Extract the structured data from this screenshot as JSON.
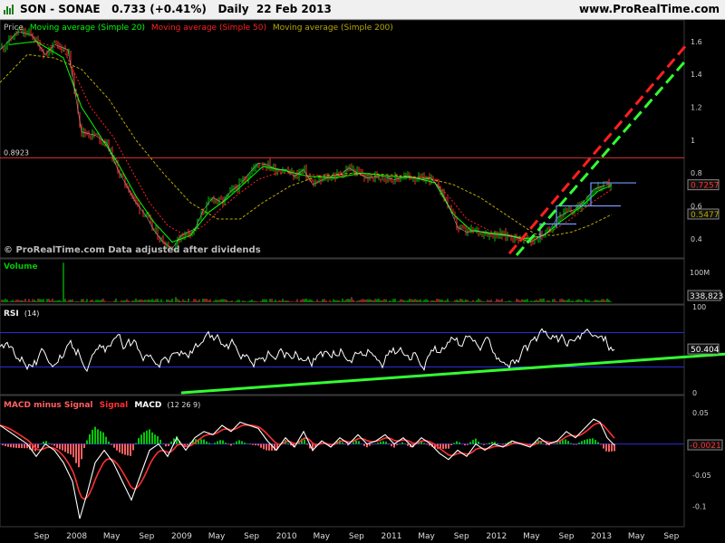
{
  "header": {
    "title": "SON - SONAE   0.733 (+0.41%)   Daily  22 Feb 2013",
    "brand": "www.ProRealTime.com"
  },
  "legend": {
    "price": "Price",
    "ma20": "Moving average (Simple 20)",
    "ma50": "Moving average (Simple 50)",
    "ma200": "Moving average (Simple 200)"
  },
  "credits": "© ProRealTime.com  Data adjusted after dividends",
  "colors": {
    "background": "#000000",
    "price_bull": "#00c800",
    "price_bear": "#ff3030",
    "ma20": "#00ff00",
    "ma50": "#ff2020",
    "ma200": "#b8a800",
    "rsi": "#ffffff",
    "band": "#2b2bd8",
    "macd": "#ffffff",
    "signal": "#ff3030",
    "trend": "#33ff33",
    "channel_red": "#ff2020",
    "channel_green": "#33ff33",
    "box": "#7799ff",
    "volume_green": "#00c800",
    "volume_red": "#d04040",
    "histogram_green": "#00c800",
    "histogram_red": "#ff6060"
  },
  "axis_x": {
    "labels": [
      "Sep",
      "2008",
      "May",
      "Sep",
      "2009",
      "May",
      "Sep",
      "2010",
      "May",
      "Sep",
      "2011",
      "May",
      "Sep",
      "2012",
      "May",
      "Sep",
      "2013",
      "May",
      "Sep"
    ]
  },
  "chart_data": [
    {
      "id": "price",
      "type": "candlestick",
      "title": "",
      "yticks": [
        1.6,
        1.4,
        1.2,
        1,
        0.8,
        0.6,
        0.4
      ],
      "ylim": [
        0.3,
        1.72
      ],
      "hline": {
        "value": 0.8923,
        "label": "0.8923"
      },
      "last": {
        "value": 0.7257,
        "label": "0.7257"
      },
      "ma200_last": {
        "value": 0.5477,
        "label": "0.5477"
      },
      "series_close": [
        [
          0,
          1.55
        ],
        [
          20,
          1.66
        ],
        [
          35,
          1.64
        ],
        [
          50,
          1.52
        ],
        [
          60,
          1.58
        ],
        [
          75,
          1.55
        ],
        [
          90,
          1.05
        ],
        [
          105,
          1.03
        ],
        [
          118,
          0.98
        ],
        [
          130,
          0.82
        ],
        [
          140,
          0.72
        ],
        [
          150,
          0.62
        ],
        [
          160,
          0.55
        ],
        [
          170,
          0.45
        ],
        [
          180,
          0.38
        ],
        [
          190,
          0.34
        ],
        [
          200,
          0.42
        ],
        [
          215,
          0.46
        ],
        [
          225,
          0.58
        ],
        [
          235,
          0.65
        ],
        [
          245,
          0.62
        ],
        [
          255,
          0.69
        ],
        [
          265,
          0.73
        ],
        [
          275,
          0.8
        ],
        [
          285,
          0.86
        ],
        [
          295,
          0.85
        ],
        [
          305,
          0.82
        ],
        [
          315,
          0.82
        ],
        [
          325,
          0.78
        ],
        [
          335,
          0.82
        ],
        [
          345,
          0.73
        ],
        [
          360,
          0.77
        ],
        [
          375,
          0.79
        ],
        [
          385,
          0.83
        ],
        [
          395,
          0.8
        ],
        [
          405,
          0.77
        ],
        [
          420,
          0.78
        ],
        [
          435,
          0.76
        ],
        [
          450,
          0.78
        ],
        [
          465,
          0.76
        ],
        [
          475,
          0.77
        ],
        [
          485,
          0.71
        ],
        [
          495,
          0.6
        ],
        [
          505,
          0.47
        ],
        [
          515,
          0.44
        ],
        [
          525,
          0.45
        ],
        [
          540,
          0.43
        ],
        [
          560,
          0.42
        ],
        [
          575,
          0.4
        ],
        [
          585,
          0.38
        ],
        [
          595,
          0.41
        ],
        [
          605,
          0.44
        ],
        [
          615,
          0.53
        ],
        [
          625,
          0.56
        ],
        [
          635,
          0.58
        ],
        [
          645,
          0.63
        ],
        [
          655,
          0.7
        ],
        [
          665,
          0.72
        ],
        [
          675,
          0.733
        ]
      ],
      "ma20": [
        [
          10,
          1.58
        ],
        [
          40,
          1.6
        ],
        [
          70,
          1.5
        ],
        [
          90,
          1.2
        ],
        [
          110,
          1.03
        ],
        [
          130,
          0.86
        ],
        [
          150,
          0.66
        ],
        [
          170,
          0.5
        ],
        [
          190,
          0.38
        ],
        [
          210,
          0.42
        ],
        [
          230,
          0.56
        ],
        [
          250,
          0.64
        ],
        [
          270,
          0.74
        ],
        [
          290,
          0.84
        ],
        [
          310,
          0.82
        ],
        [
          340,
          0.78
        ],
        [
          370,
          0.77
        ],
        [
          400,
          0.8
        ],
        [
          430,
          0.78
        ],
        [
          460,
          0.77
        ],
        [
          480,
          0.74
        ],
        [
          500,
          0.55
        ],
        [
          520,
          0.45
        ],
        [
          550,
          0.43
        ],
        [
          580,
          0.4
        ],
        [
          600,
          0.42
        ],
        [
          620,
          0.51
        ],
        [
          640,
          0.59
        ],
        [
          660,
          0.69
        ],
        [
          675,
          0.725
        ]
      ],
      "ma50": [
        [
          40,
          1.6
        ],
        [
          70,
          1.55
        ],
        [
          100,
          1.2
        ],
        [
          125,
          1.02
        ],
        [
          145,
          0.82
        ],
        [
          165,
          0.62
        ],
        [
          185,
          0.48
        ],
        [
          205,
          0.42
        ],
        [
          225,
          0.48
        ],
        [
          245,
          0.59
        ],
        [
          265,
          0.68
        ],
        [
          285,
          0.76
        ],
        [
          305,
          0.8
        ],
        [
          330,
          0.8
        ],
        [
          360,
          0.78
        ],
        [
          390,
          0.79
        ],
        [
          420,
          0.78
        ],
        [
          450,
          0.78
        ],
        [
          475,
          0.77
        ],
        [
          495,
          0.66
        ],
        [
          515,
          0.52
        ],
        [
          540,
          0.45
        ],
        [
          565,
          0.42
        ],
        [
          590,
          0.4
        ],
        [
          610,
          0.45
        ],
        [
          630,
          0.52
        ],
        [
          650,
          0.61
        ],
        [
          675,
          0.7
        ]
      ],
      "ma200": [
        [
          0,
          1.35
        ],
        [
          30,
          1.52
        ],
        [
          60,
          1.5
        ],
        [
          90,
          1.43
        ],
        [
          120,
          1.25
        ],
        [
          150,
          1.0
        ],
        [
          180,
          0.8
        ],
        [
          210,
          0.62
        ],
        [
          240,
          0.52
        ],
        [
          265,
          0.52
        ],
        [
          290,
          0.62
        ],
        [
          320,
          0.72
        ],
        [
          350,
          0.78
        ],
        [
          390,
          0.8
        ],
        [
          430,
          0.79
        ],
        [
          470,
          0.77
        ],
        [
          500,
          0.73
        ],
        [
          530,
          0.65
        ],
        [
          560,
          0.54
        ],
        [
          590,
          0.43
        ],
        [
          610,
          0.42
        ],
        [
          630,
          0.44
        ],
        [
          650,
          0.48
        ],
        [
          675,
          0.5477
        ]
      ],
      "boxes": [
        {
          "x1": 596,
          "x2": 636,
          "y1": 0.49,
          "y2": 0.4
        },
        {
          "x1": 614,
          "x2": 685,
          "y1": 0.6,
          "y2": 0.47
        },
        {
          "x1": 652,
          "x2": 702,
          "y1": 0.74,
          "y2": 0.6
        }
      ],
      "channels": [
        {
          "color": "red",
          "x1": 562,
          "y1": 0.31,
          "x2": 756,
          "y2": 1.57
        },
        {
          "color": "green",
          "x1": 570,
          "y1": 0.3,
          "x2": 756,
          "y2": 1.48
        }
      ]
    },
    {
      "id": "volume",
      "type": "bar",
      "title": "Volume",
      "ytick_label": "100M",
      "ymax": 100,
      "last": {
        "label": "338,823"
      },
      "spike": {
        "x": 70,
        "value": 95
      }
    },
    {
      "id": "rsi",
      "type": "line",
      "title": "RSI",
      "param": "(14)",
      "yticks": [
        100,
        50,
        0
      ],
      "ylim": [
        0,
        100
      ],
      "bands": [
        70,
        30
      ],
      "last": {
        "value": 50.404,
        "label": "50.404"
      },
      "trendline": {
        "x1": 200,
        "y1": 0,
        "x2": 800,
        "y2": 45
      }
    },
    {
      "id": "macd",
      "type": "line",
      "title": "MACD minus Signal  Signal  MACD",
      "labels": {
        "hist": "MACD minus Signal",
        "signal": "Signal",
        "macd": "MACD"
      },
      "param": "(12 26 9)",
      "yticks": [
        0.05,
        0,
        -0.05,
        -0.1
      ],
      "ylim": [
        -0.13,
        0.075
      ],
      "last": {
        "value": -0.0021,
        "label": "-0.0021"
      },
      "macd_points": [
        [
          0,
          0.03
        ],
        [
          10,
          0.02
        ],
        [
          20,
          0.01
        ],
        [
          30,
          0.0
        ],
        [
          40,
          -0.02
        ],
        [
          50,
          0.0
        ],
        [
          60,
          -0.01
        ],
        [
          70,
          -0.03
        ],
        [
          80,
          -0.06
        ],
        [
          88,
          -0.12
        ],
        [
          96,
          -0.08
        ],
        [
          105,
          -0.03
        ],
        [
          115,
          -0.01
        ],
        [
          125,
          -0.03
        ],
        [
          135,
          -0.06
        ],
        [
          145,
          -0.09
        ],
        [
          155,
          -0.05
        ],
        [
          165,
          -0.01
        ],
        [
          175,
          0.0
        ],
        [
          185,
          -0.02
        ],
        [
          195,
          0.01
        ],
        [
          205,
          -0.01
        ],
        [
          215,
          0.01
        ],
        [
          225,
          0.02
        ],
        [
          235,
          0.015
        ],
        [
          245,
          0.03
        ],
        [
          255,
          0.02
        ],
        [
          265,
          0.035
        ],
        [
          275,
          0.03
        ],
        [
          285,
          0.025
        ],
        [
          295,
          0.005
        ],
        [
          305,
          -0.01
        ],
        [
          315,
          0.01
        ],
        [
          325,
          -0.005
        ],
        [
          335,
          0.02
        ],
        [
          345,
          -0.01
        ],
        [
          355,
          0.005
        ],
        [
          365,
          -0.005
        ],
        [
          375,
          0.01
        ],
        [
          385,
          0.0
        ],
        [
          395,
          0.015
        ],
        [
          405,
          0.0
        ],
        [
          415,
          0.005
        ],
        [
          425,
          0.015
        ],
        [
          435,
          0.0
        ],
        [
          445,
          0.01
        ],
        [
          455,
          -0.005
        ],
        [
          465,
          0.01
        ],
        [
          475,
          0.0
        ],
        [
          485,
          -0.015
        ],
        [
          495,
          -0.025
        ],
        [
          505,
          -0.01
        ],
        [
          515,
          -0.02
        ],
        [
          525,
          0.0
        ],
        [
          535,
          -0.01
        ],
        [
          545,
          0.0
        ],
        [
          555,
          -0.005
        ],
        [
          565,
          0.005
        ],
        [
          575,
          0.0
        ],
        [
          585,
          -0.005
        ],
        [
          595,
          0.01
        ],
        [
          605,
          0.0
        ],
        [
          615,
          0.005
        ],
        [
          625,
          0.02
        ],
        [
          635,
          0.01
        ],
        [
          645,
          0.025
        ],
        [
          655,
          0.04
        ],
        [
          662,
          0.035
        ],
        [
          670,
          0.01
        ],
        [
          678,
          -0.002
        ]
      ]
    }
  ]
}
